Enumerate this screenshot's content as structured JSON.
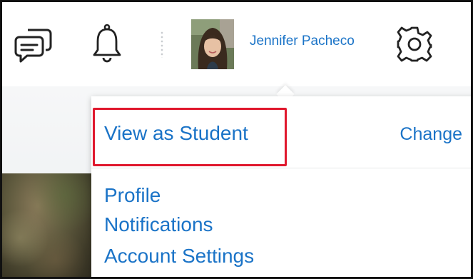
{
  "header": {
    "icons": [
      "conversations-icon",
      "notifications-bell-icon",
      "settings-gear-icon"
    ],
    "user": {
      "name": "Jennifer Pacheco",
      "avatar": "user-avatar-photo"
    }
  },
  "popover": {
    "student_view": {
      "label": "View as Student",
      "action_label": "Change"
    },
    "items": [
      {
        "label": "Profile"
      },
      {
        "label": "Notifications"
      },
      {
        "label": "Account Settings"
      }
    ]
  },
  "colors": {
    "link": "#1a73c7",
    "highlight_border": "#e0182d",
    "icon_stroke": "#222222",
    "divider": "#c9ccd0",
    "frame_border": "#111111"
  }
}
